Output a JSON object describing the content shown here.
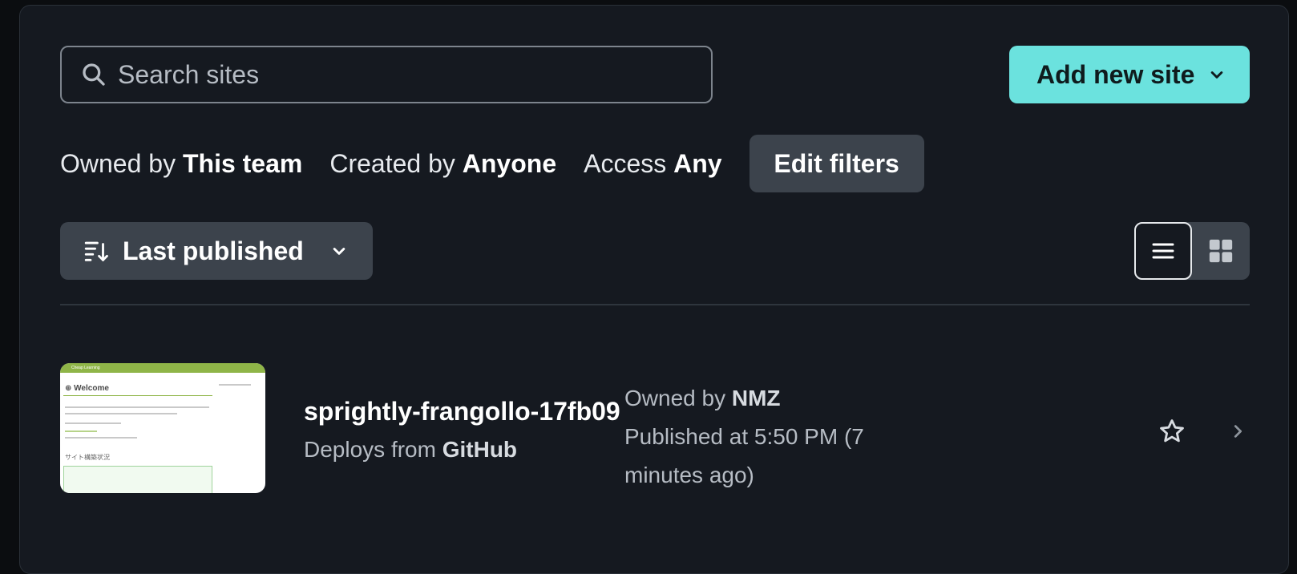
{
  "search": {
    "placeholder": "Search sites"
  },
  "header": {
    "add_site_label": "Add new site"
  },
  "filters": {
    "owned_prefix": "Owned by",
    "owned_value": "This team",
    "created_prefix": "Created by",
    "created_value": "Anyone",
    "access_prefix": "Access",
    "access_value": "Any",
    "edit_label": "Edit filters"
  },
  "sort": {
    "label": "Last published"
  },
  "view": {
    "active": "list",
    "options": [
      "list",
      "grid"
    ]
  },
  "sites": [
    {
      "name": "sprightly-frangollo-17fb09",
      "deploys_prefix": "Deploys from",
      "deploys_source": "GitHub",
      "owned_prefix": "Owned by",
      "owner": "NMZ",
      "published": "Published at 5:50 PM (7 minutes ago)",
      "thumbnail": {
        "bar_title": "Cheap Learning",
        "heading": "Welcome",
        "section": "サイト構築状況"
      }
    }
  ],
  "colors": {
    "accent": "#6be2de",
    "panel": "#151920",
    "button": "#3c434c"
  }
}
